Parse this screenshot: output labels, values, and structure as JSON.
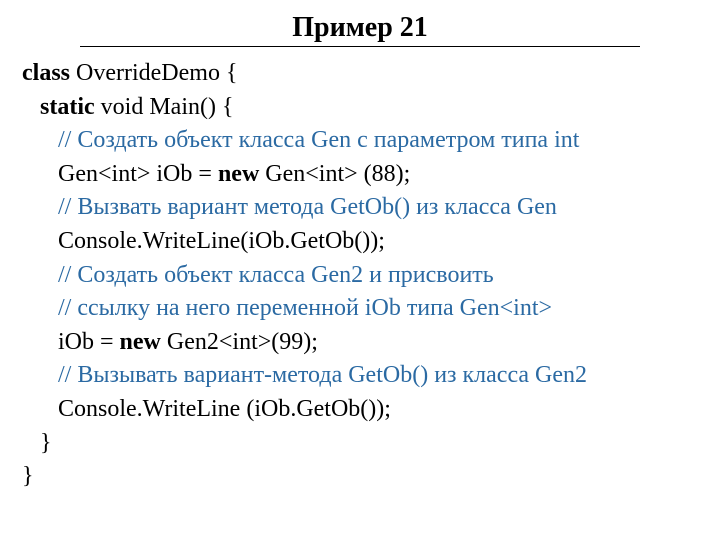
{
  "title": "Пример 21",
  "code": {
    "l1": {
      "kw": "class",
      "rest": " OverrideDemo {"
    },
    "l2": {
      "pad": "   ",
      "kw": "static",
      "rest": " void Main() {"
    },
    "l3": {
      "pad": "      ",
      "cm": "// Создать объект класса Gen с параметром типа int"
    },
    "l4": {
      "pad": "      ",
      "a": "Gen<int> iOb = ",
      "kw": "new",
      "b": " Gen<int> (88);"
    },
    "l5": {
      "pad": "      ",
      "cm": "// Вызвать вариант метода GetOb() из класса Gen"
    },
    "l6": {
      "pad": "      ",
      "txt": "Console.WriteLine(iOb.GetOb());"
    },
    "l7": {
      "pad": "      ",
      "cm": "// Создать объект класса Gen2 и присвоить"
    },
    "l8": {
      "pad": "      ",
      "cm": "// ссылку на него переменной iOb типа Gen<int>"
    },
    "l9": {
      "pad": "      ",
      "a": "iOb = ",
      "kw": "new",
      "b": " Gen2<int>(99);"
    },
    "l10": {
      "pad": "      ",
      "cm": "// Вызывать вариант-метода GetOb() из класса Gen2"
    },
    "l11": {
      "pad": "      ",
      "txt": "Console.WriteLine (iOb.GetOb());"
    },
    "l12": {
      "pad": "   ",
      "txt": "}"
    },
    "l13": {
      "txt": "}"
    }
  }
}
